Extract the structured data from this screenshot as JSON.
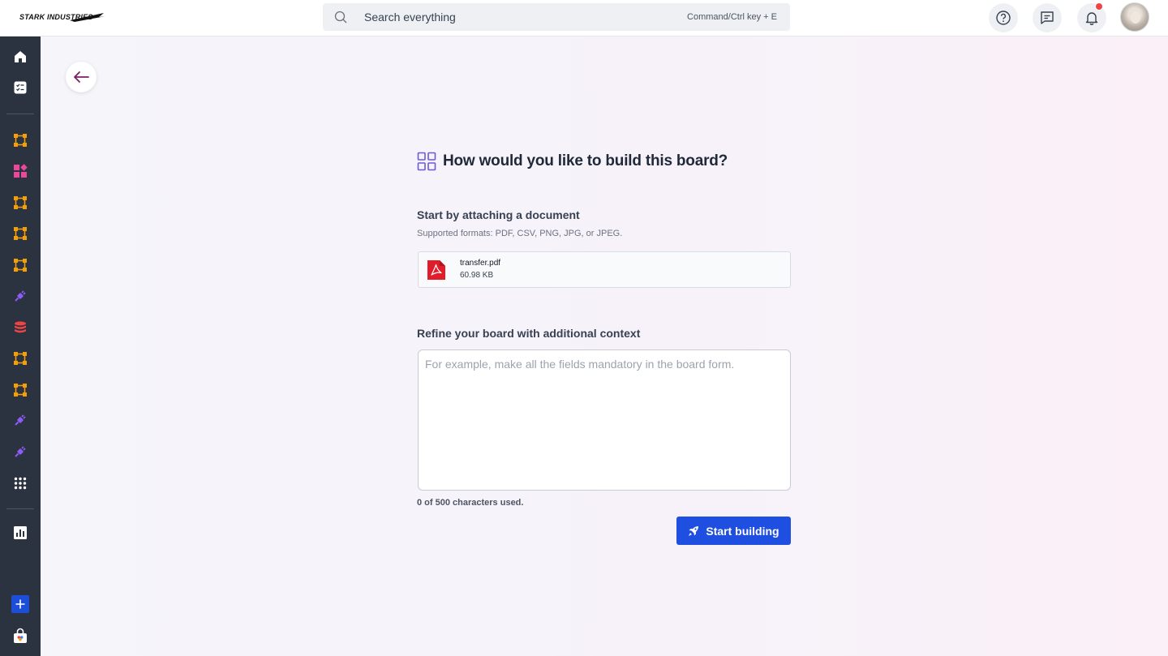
{
  "brand": {
    "name": "STARK INDUSTRIES"
  },
  "search": {
    "placeholder": "Search everything",
    "shortcut": "Command/Ctrl key + E"
  },
  "topbar": {
    "icons": [
      "help-circle-icon",
      "feedback-icon",
      "bell-icon"
    ],
    "has_notification": true
  },
  "sidebar": {
    "items": [
      {
        "icon": "home-icon",
        "color": "#ffffff"
      },
      {
        "icon": "task-list-icon",
        "color": "#ffffff"
      },
      {
        "icon": "board-nodes-icon",
        "color": "#f59e0b"
      },
      {
        "icon": "apps-grid-icon",
        "color": "#ec4899"
      },
      {
        "icon": "board-nodes-icon",
        "color": "#f59e0b"
      },
      {
        "icon": "board-nodes-icon",
        "color": "#f59e0b"
      },
      {
        "icon": "board-nodes-icon",
        "color": "#f59e0b"
      },
      {
        "icon": "integration-plug-icon",
        "color": "#8b5cf6"
      },
      {
        "icon": "database-icon",
        "color": "#ef4444"
      },
      {
        "icon": "board-nodes-icon",
        "color": "#f59e0b"
      },
      {
        "icon": "board-nodes-icon",
        "color": "#f59e0b"
      },
      {
        "icon": "integration-plug-icon",
        "color": "#8b5cf6"
      },
      {
        "icon": "integration-plug-icon",
        "color": "#8b5cf6"
      },
      {
        "icon": "dots-grid-icon",
        "color": "#ffffff"
      },
      {
        "icon": "bar-chart-icon",
        "color": "#ffffff"
      },
      {
        "icon": "plus-icon",
        "color": "#1d4ed8"
      },
      {
        "icon": "store-bag-icon",
        "color": "#ffffff"
      }
    ]
  },
  "page": {
    "heading": "How would you like to build this board?",
    "attach": {
      "title": "Start by attaching a document",
      "subtitle": "Supported formats: PDF, CSV, PNG, JPG, or JPEG.",
      "file": {
        "name": "transfer.pdf",
        "size": "60.98 KB"
      }
    },
    "context": {
      "title": "Refine your board with additional context",
      "placeholder": "For example, make all the fields mandatory in the board form.",
      "value": "",
      "char_count": "0 of 500 characters used."
    },
    "start_button": "Start building"
  },
  "colors": {
    "accent": "#1e4fe0",
    "heading_icon": "#6b5bd6",
    "back_arrow": "#7b1f63",
    "pdf_red": "#e11d2a"
  }
}
